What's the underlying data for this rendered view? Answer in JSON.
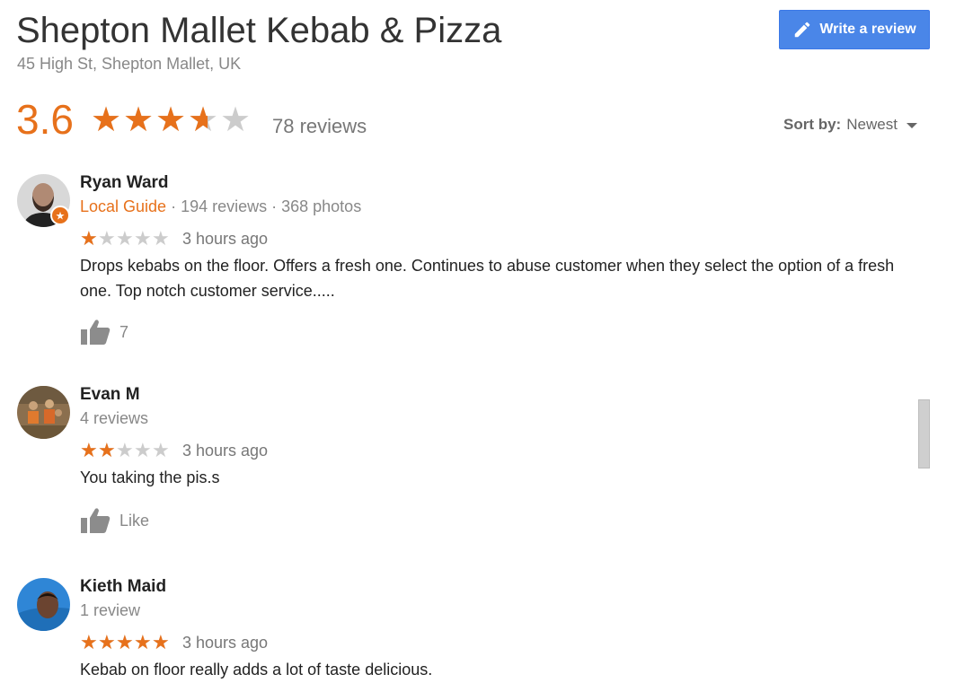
{
  "place": {
    "title": "Shepton Mallet Kebab & Pizza",
    "address": "45 High St, Shepton Mallet, UK",
    "rating_text": "3.6",
    "rating_value": 3.6,
    "reviews_count": "78 reviews"
  },
  "toolbar": {
    "write_review_label": "Write a review",
    "sort_label": "Sort by:",
    "sort_value": "Newest"
  },
  "colors": {
    "accent": "#e7711b",
    "button": "#4a86e8"
  },
  "reviews": [
    {
      "name": "Ryan Ward",
      "guide": "Local Guide",
      "meta": " · 194 reviews · 368 photos",
      "stars": 1,
      "time": "3 hours ago",
      "text": "Drops kebabs on the floor. Offers a fresh one. Continues to abuse customer when they select the option of a fresh one. Top notch customer service.....",
      "likes": "7"
    },
    {
      "name": "Evan M",
      "guide": "",
      "meta": "4 reviews",
      "stars": 2,
      "time": "3 hours ago",
      "text": "You taking the pis.s",
      "likes": "Like"
    },
    {
      "name": "Kieth Maid",
      "guide": "",
      "meta": "1 review",
      "stars": 5,
      "time": "3 hours ago",
      "text": "Kebab on floor really adds a lot of taste delicious.",
      "likes": ""
    }
  ]
}
